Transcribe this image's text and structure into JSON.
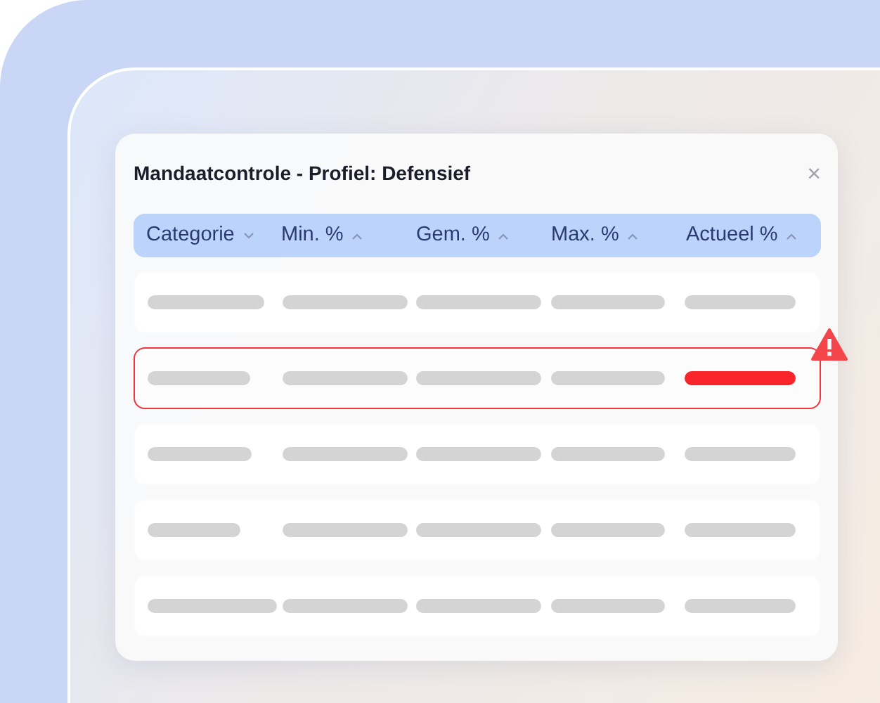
{
  "dialog": {
    "title": "Mandaatcontrole - Profiel: Defensief",
    "close": "×"
  },
  "table": {
    "columns": [
      {
        "label": "Categorie",
        "sort_ascending": false
      },
      {
        "label": "Min. %",
        "sort_ascending": true
      },
      {
        "label": "Gem. %",
        "sort_ascending": true
      },
      {
        "label": "Max. %",
        "sort_ascending": true
      },
      {
        "label": "Actueel %",
        "sort_ascending": true
      }
    ],
    "rows": [
      {
        "flagged": false
      },
      {
        "flagged": true
      },
      {
        "flagged": false
      },
      {
        "flagged": false
      },
      {
        "flagged": false
      }
    ]
  }
}
